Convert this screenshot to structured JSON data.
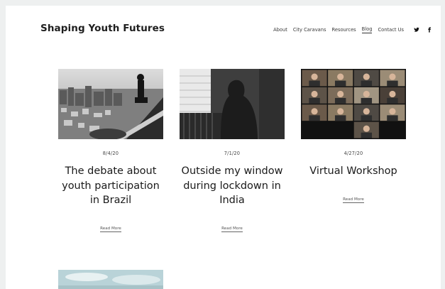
{
  "site": {
    "title": "Shaping Youth Futures"
  },
  "nav": {
    "links": [
      {
        "label": "About",
        "active": false
      },
      {
        "label": "City Caravans",
        "active": false
      },
      {
        "label": "Resources",
        "active": false
      },
      {
        "label": "Blog",
        "active": true
      },
      {
        "label": "Contact Us",
        "active": false
      }
    ],
    "social": [
      "twitter-icon",
      "facebook-icon"
    ]
  },
  "posts": [
    {
      "date": "8/4/20",
      "title": "The debate about youth participation in Brazil",
      "read_more": "Read More"
    },
    {
      "date": "7/1/20",
      "title": "Outside my window during lockdown in India",
      "read_more": "Read More"
    },
    {
      "date": "4/27/20",
      "title": "Virtual Workshop",
      "read_more": "Read More"
    }
  ]
}
